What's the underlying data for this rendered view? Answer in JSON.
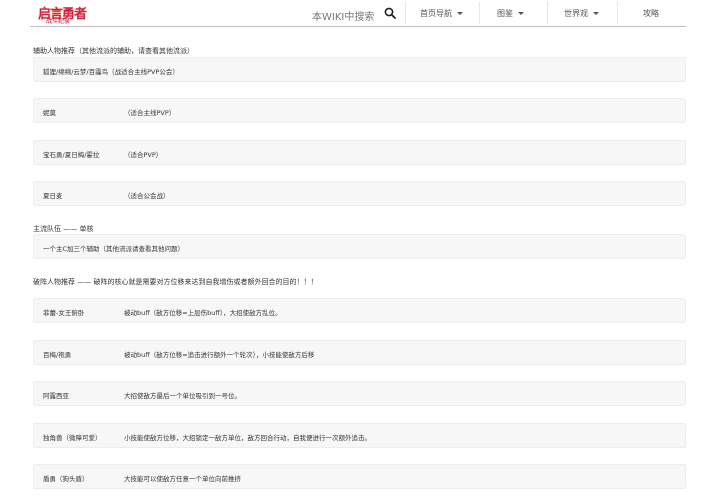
{
  "header": {
    "logo_main": "启言勇者",
    "logo_sub": "战斗纪录",
    "search_label": "本WIKI中搜索",
    "nav": [
      "首页导航",
      "图鉴",
      "世界观",
      "攻略"
    ]
  },
  "section_support": {
    "title": "辅助人物推荐（其他流派的辅助，请查看其他流派）",
    "rows": [
      {
        "name": "狐狸/绵绵/云梦/百霾鸟（战适合主线PVP公会）",
        "note": ""
      },
      {
        "name": "妮莫",
        "note": "（适合主线PVP）"
      },
      {
        "name": "宝石勇/夏日梅/霍拉",
        "note": "（适合PVP）"
      },
      {
        "name": "夏日麦",
        "note": "（适合公会战）"
      }
    ]
  },
  "section_team": {
    "title": "主流队伍 —— 单核",
    "rows": [
      {
        "name": "一个主C加三个辅助（其他流派请查看其他问题）",
        "note": ""
      }
    ]
  },
  "section_breaker": {
    "title": "破阵人物推荐 —— 破阵的核心就是需要对方位移来达到自我增伤或者额外回合的目的！！！",
    "rows": [
      {
        "name": "菲蕾-女王俯卧",
        "note": "被动buff（敌方位移=上层伤buff），大招使敌方乱位。"
      },
      {
        "name": "百梅/袍勇",
        "note": "被动buff（敌方位移=追击进行额外一个轮次），小技能使敌方后移"
      },
      {
        "name": "阿露西亚",
        "note": "大招使敌方最后一个单位吸引到一号位。"
      },
      {
        "name": "独角兽（微障可爱）",
        "note": "小技能使敌方位移，大招锁定一敌方单位，敌方回合行动，自我便进行一次额外追击。"
      },
      {
        "name": "盾勇（狗头盾）",
        "note": "大技能可以使敌方任意一个单位向前推挤"
      }
    ]
  }
}
